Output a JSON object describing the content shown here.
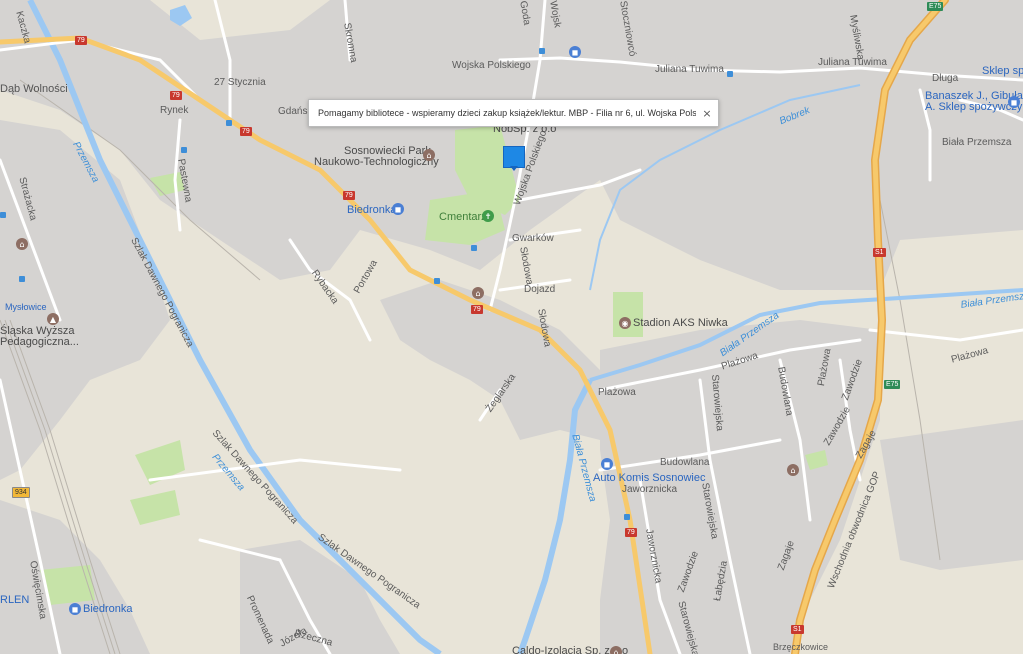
{
  "infobox": {
    "text": "Pomagamy bibliotece - wspieramy dzieci zakup książek/lektur. MBP - Filia nr 6, ul. Wojska Polskiego.",
    "close": "×"
  },
  "streets": {
    "wojska_polskiego_top": "Wojska Polskiego",
    "wojska_polskiego_mid": "Wojska Polskiego",
    "juliana_tuwima_1": "Juliana Tuwima",
    "juliana_tuwima_2": "Juliana Tuwima",
    "dluga": "Długa",
    "stycznia": "27 Stycznia",
    "gdanska": "Gdańsk",
    "skromna": "Skromna",
    "rynek": "Rynek",
    "pastewna": "Pastewna",
    "strazacka": "Strażacka",
    "kaczka": "Kaczka",
    "gwarkow": "Gwarków",
    "slodowa_1": "Słodowa",
    "slodowa_2": "Słodowa",
    "dojazd": "Dojazd",
    "rybacka": "Rybacka",
    "portowa": "Portowa",
    "zeglarska": "Żeglarska",
    "plazowa_1": "Plażowa",
    "plazowa_2": "Plażowa",
    "plazowa_3": "Plażowa",
    "plazowa_4": "Plażowa",
    "budowlana_1": "Budowlana",
    "budowlana_2": "Budowlana",
    "starowiejska_1": "Starowiejska",
    "starowiejska_2": "Starowiejska",
    "starowiejska_3": "Starowiejska",
    "zawodzie_1": "Zawodzie",
    "zawodzie_2": "Zawodzie",
    "zawodzie_3": "Zawodzie",
    "zagaje_1": "Zagaje",
    "zagaje_2": "Zagaje",
    "jaworznicka_1": "Jaworznicka",
    "jaworznicka_2": "Jaworznicka",
    "labedzia": "Łabędzia",
    "szlak_1": "Szlak Dawnego Pogranicza",
    "szlak_2": "Szlak Dawnego Pogranicza",
    "szlak_3": "Szlak Dawnego Pogranicza",
    "oswiecimska": "Oświęcimska",
    "promenada": "Promenada",
    "rzeczna": "Rzeczna",
    "jozefa": "Józefa",
    "mysliwska": "Myśliwska",
    "stoczniowcow": "Stoczniowcó",
    "goda": "Goda",
    "wojska": "Wojsk",
    "bialaprzemsza": "Biała Przemsza",
    "wschodnia": "Wschodnia obwodnica GOP",
    "brzeczkowice": "Brzęczkowice"
  },
  "water": {
    "przemsza_1": "Przemsza",
    "przemsza_2": "Przemsza",
    "bobrek": "Bobrek",
    "biala_przemsza_1": "Biała Przemsza",
    "biala_przemsza_2": "Biała Przemsza",
    "biala_przemsza_3": "Biała Przemsza"
  },
  "places": {
    "dab_wolnosci": "Dąb Wolności",
    "sosnowiecki_park_1": "Sosnowiecki Park",
    "sosnowiecki_park_2": "Naukowo-Technologiczny",
    "biedronka_1": "Biedronka",
    "biedronka_2": "Biedronka",
    "cmentarz": "Cmentarz",
    "stadion": "Stadion AKS Niwka",
    "auto_komis": "Auto Komis Sosnowiec",
    "myslowice": "Mysłowice",
    "wyzsza_1": "Śląska Wyższa",
    "wyzsza_2": "Pedagogiczna...",
    "sklep_spo": "Sklep spo",
    "banaszek_1": "Banaszek J., Gibuła",
    "banaszek_2": "A. Sklep spożywczy",
    "nobe": "Nob",
    "sp": "Sp. z o.o",
    "orlen": "RLEN",
    "caldo": "Caldo-Izolacja Sp. z o.o"
  },
  "shields": {
    "r79": "79",
    "s1": "S1",
    "e75": "E75",
    "r934": "934"
  },
  "icons": {
    "close": "close-icon",
    "pin": "map-marker-icon",
    "shopping": "shopping-bag-icon",
    "bus": "bus-stop-icon",
    "cemetery": "cemetery-icon",
    "stadium": "stadium-icon",
    "school": "school-icon",
    "museum": "museum-icon"
  },
  "colors": {
    "land": "#e8e4d8",
    "urban": "#d5d3d1",
    "road": "#ffffff",
    "highway": "#f7c96b",
    "river": "#9cc8f2",
    "river_label": "#3d8fd8",
    "park": "#c6e3a8",
    "poi_blue": "#4a7fd4",
    "poi_brown": "#8d6e63",
    "poi_green": "#3f9c4a",
    "pin": "#1e88e5"
  }
}
